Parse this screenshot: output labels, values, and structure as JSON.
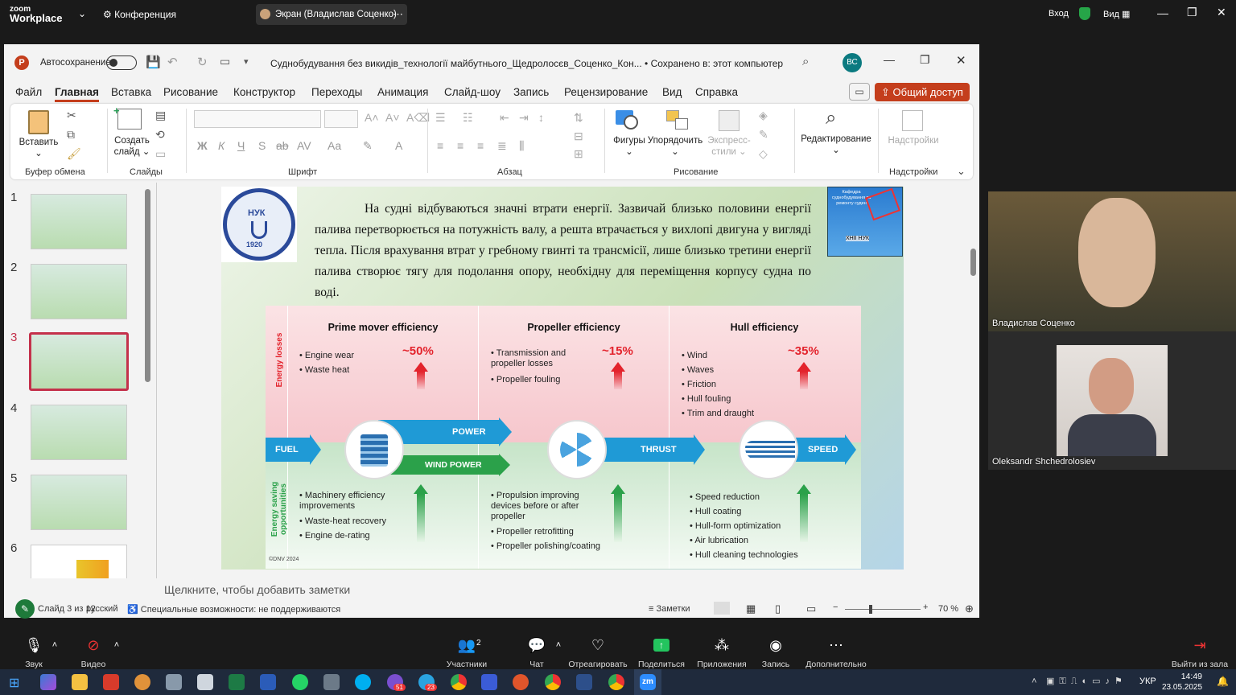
{
  "zoom": {
    "logo_top": "zoom",
    "logo_bottom": "Workplace",
    "conference": "Конференция",
    "screen_share": "Экран (Владислав Соценко)",
    "login": "Вход",
    "view": "Вид"
  },
  "ppt": {
    "autosave": "Автосохранение",
    "title": "Суднобудування без викидів_технології майбутнього_Щедролосєв_Соценко_Кон... • Сохранено в: этот компьютер",
    "user_initials": "ВС",
    "menu": [
      "Файл",
      "Главная",
      "Вставка",
      "Рисование",
      "Конструктор",
      "Переходы",
      "Анимация",
      "Слайд-шоу",
      "Запись",
      "Рецензирование",
      "Вид",
      "Справка"
    ],
    "share": "Общий доступ",
    "ribbon": {
      "paste": "Вставить",
      "new_slide_1": "Создать",
      "new_slide_2": "слайд",
      "clipboard": "Буфер обмена",
      "slides": "Слайды",
      "font": "Шрифт",
      "paragraph": "Абзац",
      "shapes": "Фигуры",
      "arrange": "Упорядочить",
      "express_1": "Экспресс-",
      "express_2": "стили",
      "drawing": "Рисование",
      "editing": "Редактирование",
      "addins": "Надстройки",
      "addins_group": "Надстройки"
    },
    "thumb_numbers": [
      "1",
      "2",
      "3",
      "4",
      "5",
      "6"
    ],
    "notes_placeholder": "Щелкните, чтобы добавить заметки",
    "status": {
      "slide": "Слайд 3 из 12",
      "lang": "русский",
      "access": "Специальные возможности: не поддерживаются",
      "notes": "Заметки",
      "zoom": "70 %"
    }
  },
  "slide": {
    "text": "На судні відбуваються значні втрати енергії. Зазвичай близько половини енергії палива перетворюється на потужність валу, а решта втрачається у вихлопі двигуна у вигляді тепла. Після врахування втрат у гребному гвинті та трансмісії, лише близько третини енергії палива створює тягу для подолання опору, необхідну для переміщення корпусу судна по воді.",
    "logo_text": "НУК",
    "logo_year": "1920",
    "badge_text": "ХНІІ НУК",
    "badge_title": "Кафедра суднобудування та ремонту суден",
    "fig": {
      "side_top": "Energy losses",
      "side_bottom": "Energy saving opportunities",
      "cols": [
        {
          "title": "Prime mover efficiency",
          "pct": "~50%",
          "losses": [
            "Engine wear",
            "Waste heat"
          ],
          "savings": [
            "Machinery efficiency improvements",
            "Waste-heat recovery",
            "Engine de-rating"
          ]
        },
        {
          "title": "Propeller efficiency",
          "pct": "~15%",
          "losses": [
            "Transmission and propeller losses",
            "Propeller fouling"
          ],
          "savings": [
            "Propulsion improving devices before or after propeller",
            "Propeller retrofitting",
            "Propeller polishing/coating"
          ]
        },
        {
          "title": "Hull efficiency",
          "pct": "~35%",
          "losses": [
            "Wind",
            "Waves",
            "Friction",
            "Hull fouling",
            "Trim and draught"
          ],
          "savings": [
            "Speed reduction",
            "Hull coating",
            "Hull-form optimization",
            "Air lubrication",
            "Hull cleaning technologies"
          ]
        }
      ],
      "flow": {
        "fuel": "FUEL",
        "power": "POWER",
        "wind": "WIND POWER",
        "thrust": "THRUST",
        "speed": "SPEED"
      },
      "credit": "©DNV 2024"
    }
  },
  "video": {
    "p1": "Владислав Соценко",
    "p2": "Oleksandr Shchedrolosiev"
  },
  "controls": [
    {
      "label": "Звук"
    },
    {
      "label": "Видео"
    },
    {
      "label": "Участники",
      "count": "2"
    },
    {
      "label": "Чат"
    },
    {
      "label": "Отреагировать"
    },
    {
      "label": "Поделиться"
    },
    {
      "label": "Приложения"
    },
    {
      "label": "Запись"
    },
    {
      "label": "Дополнительно"
    },
    {
      "label": "Выйти из зала"
    }
  ],
  "taskbar": {
    "lang": "УКР",
    "time": "14:49",
    "date": "23.05.2025",
    "badge1": "51",
    "badge2": "23"
  }
}
